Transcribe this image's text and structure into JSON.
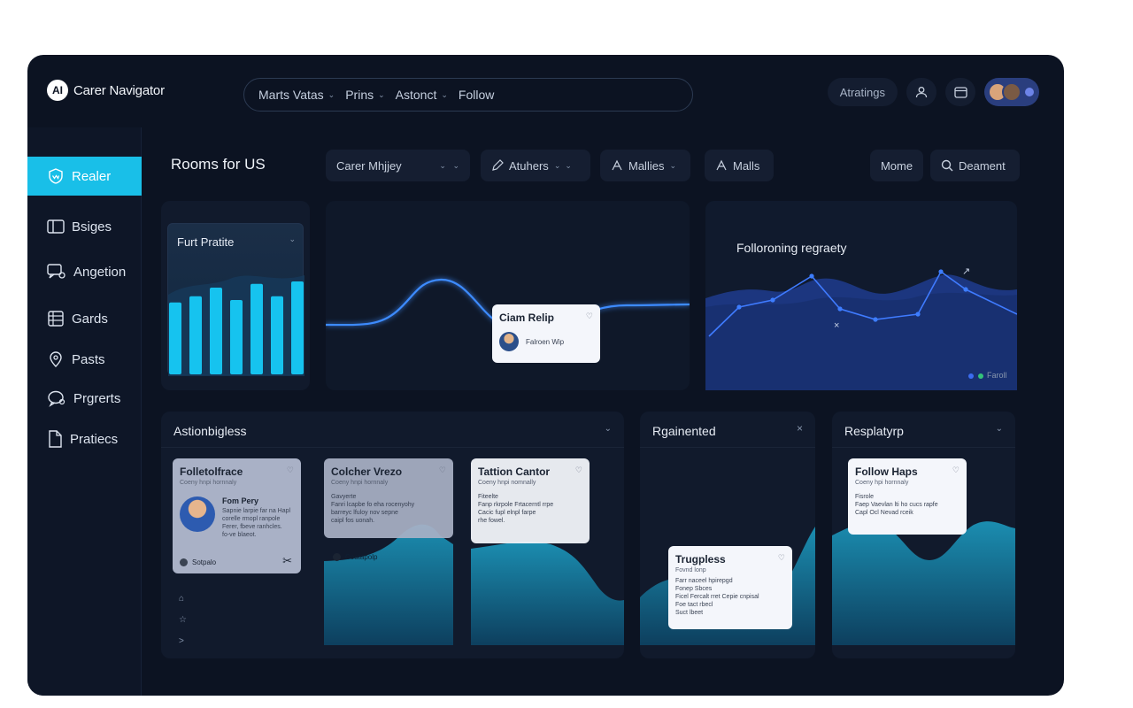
{
  "app": {
    "logo_text": "AI",
    "name": "Carer Navigator"
  },
  "topnav": {
    "items": [
      "Marts Vatas",
      "Prins",
      "Astonct",
      "Follow"
    ]
  },
  "header_right": {
    "button_label": "Atratings"
  },
  "sidebar": {
    "items": [
      {
        "label": "Realer",
        "icon": "shield-icon",
        "active": true
      },
      {
        "label": "Bsiges",
        "icon": "panel-icon"
      },
      {
        "label": "Angetion",
        "icon": "chat-icon"
      },
      {
        "label": "Gards",
        "icon": "grid-icon"
      },
      {
        "label": "Pasts",
        "icon": "pin-icon"
      },
      {
        "label": "Prgrerts",
        "icon": "bubble-icon"
      },
      {
        "label": "Pratiecs",
        "icon": "document-icon"
      }
    ]
  },
  "toolbar": {
    "title": "Rooms for US",
    "filters": [
      "Carer Mhjjey",
      "Atuhers",
      "Mallies",
      "Malls"
    ],
    "more_label": "Mome",
    "search_label": "Deament"
  },
  "panels": {
    "profile": {
      "title": "Furt Pratite",
      "bar_levels": [
        0.58,
        0.63,
        0.7,
        0.6,
        0.73,
        0.63,
        0.75
      ]
    },
    "wave_tooltip": {
      "title": "Ciam Relip",
      "subtitle": "Falroen Wip"
    },
    "regression": {
      "title": "Folloroning regraety",
      "legend_label": "Faroll"
    },
    "actions": {
      "title": "Astionbigless",
      "cards": [
        {
          "title": "Folletolfrace",
          "subtitle": "Coeny hnpi hornnaly",
          "name": "Fom Pery",
          "text": "Sapnie larpie far na Hapl\ncorelle rmopl ranpole\nFerer, fbeve ranhcles.\nfo-ve blaeot.",
          "footer": "Sotpalo"
        },
        {
          "title": "Colcher Vrezo",
          "subtitle": "Coeny hnpi hornnaly",
          "text": "Gavyerte\nFanri lcapbe fo eha rocenyohy\nbarreyc lfuloy nov sepne\ncaipl fos uonah.",
          "footer": "Coatapolp"
        },
        {
          "title": "Tattion Cantor",
          "subtitle": "Coeny hnpi nomnally",
          "text": "Fiteelte\nFanp rkrpole Frtacerntl rrpe\nCacic fupl elnpl farpe\nrhe fowel."
        }
      ]
    },
    "ragiented": {
      "title": "Rgainented",
      "card": {
        "title": "Trugpless",
        "subtitle": "Fovnd lonp",
        "text": "Farr naceel hpirepgd\nFonep Sbces\nFicel Fercalt rret Cepie cnpisal\nFoe tact rbecl\nSuct lbeet"
      }
    },
    "resplatyrp": {
      "title": "Resplatyrp",
      "card": {
        "title": "Follow Haps",
        "subtitle": "Coeny hpi hornnaly",
        "text": "Fisrole\nFaep Vaevlan lti ho cucs rapfe\nCapl Ocl Nevad rceik"
      }
    }
  },
  "colors": {
    "background": "#0c1322",
    "accent": "#19bfe8",
    "wave": "#3d8bff",
    "area": "#1f3c8e"
  }
}
